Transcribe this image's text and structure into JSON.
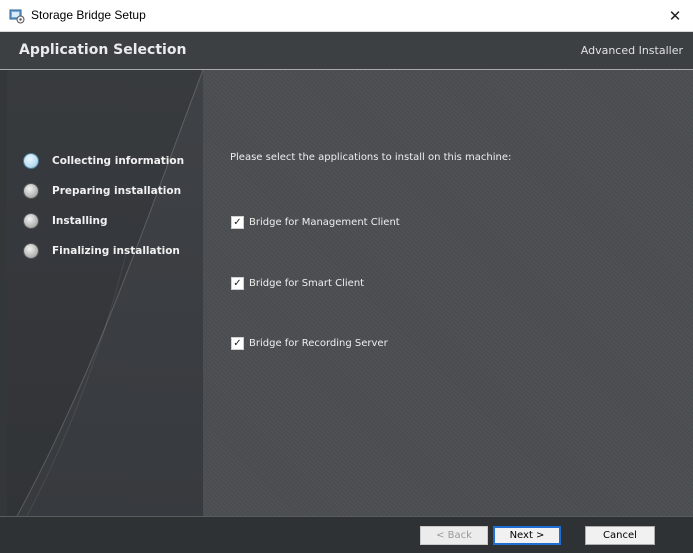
{
  "window": {
    "title": "Storage Bridge Setup",
    "close_glyph": "✕"
  },
  "header": {
    "title": "Application Selection",
    "brand": "Advanced Installer"
  },
  "sidebar": {
    "steps": [
      {
        "label": "Collecting information",
        "active": true
      },
      {
        "label": "Preparing installation",
        "active": false
      },
      {
        "label": "Installing",
        "active": false
      },
      {
        "label": "Finalizing installation",
        "active": false
      }
    ]
  },
  "main": {
    "prompt": "Please select the applications to install on this machine:",
    "options": [
      {
        "label": "Bridge for Management Client",
        "checked": true
      },
      {
        "label": "Bridge for Smart Client",
        "checked": true
      },
      {
        "label": "Bridge for Recording Server",
        "checked": true
      }
    ],
    "check_glyph": "✓"
  },
  "footer": {
    "back_label": "< Back",
    "next_label": "Next >",
    "cancel_label": "Cancel"
  },
  "colors": {
    "header_bg": "#3d4043",
    "panel_bg": "#4a4d50",
    "sidebar_bg": "#3f4246",
    "active_step": "#bfe0f3",
    "focus_border": "#1e6ed4"
  }
}
